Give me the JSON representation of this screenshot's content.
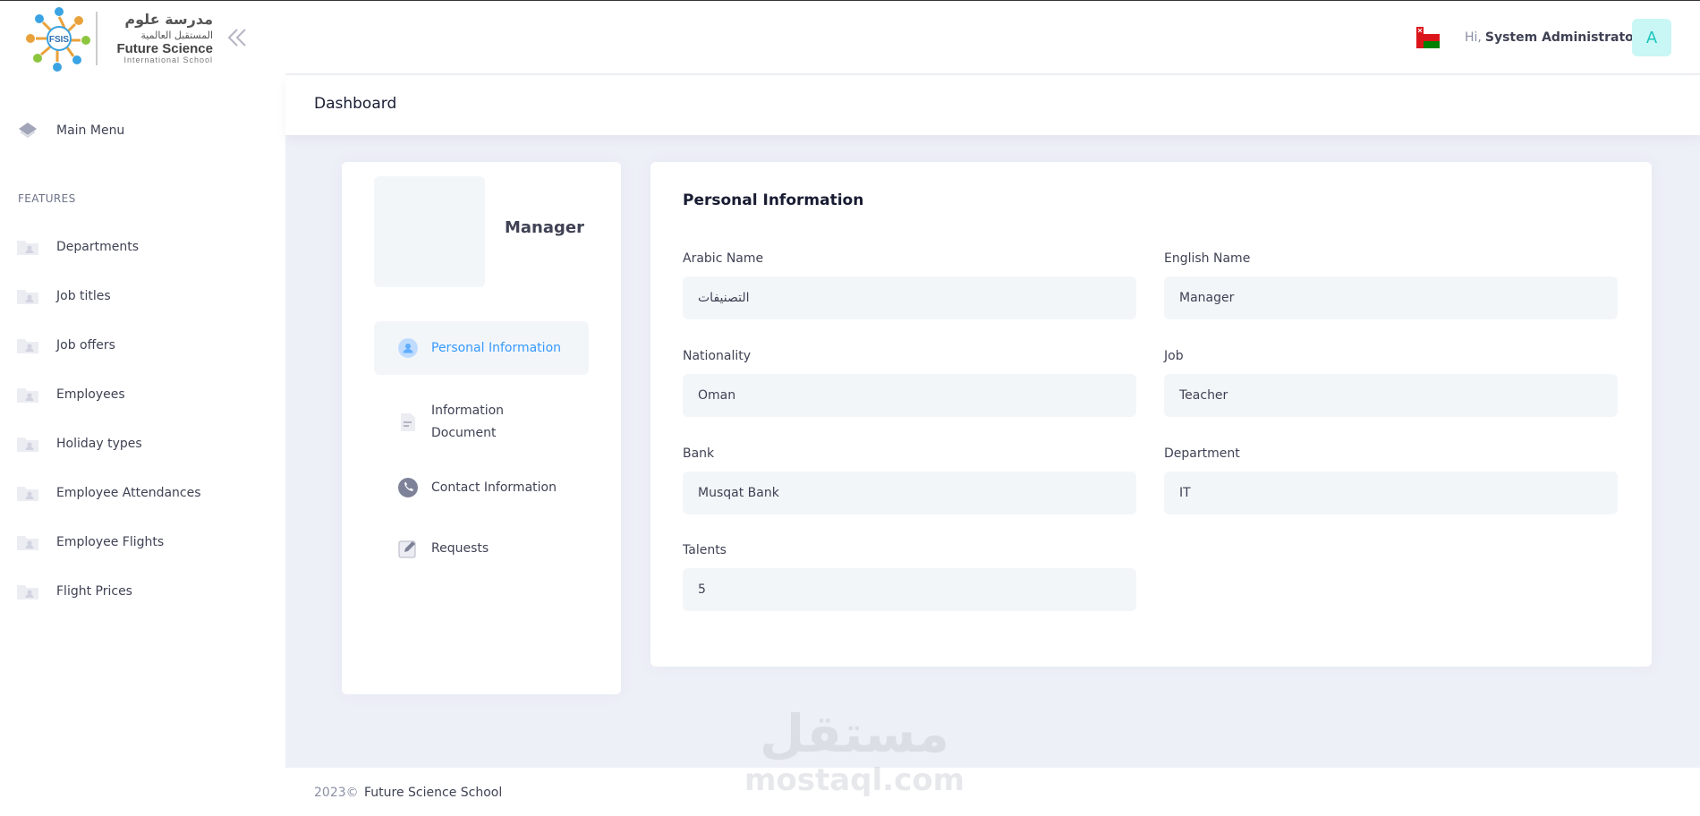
{
  "brand": {
    "logo_abbrev": "FSIS",
    "arabic_name_line1": "مدرسة علوم",
    "arabic_name_line2": "المستقبل العالمية",
    "english_name": "Future Science",
    "english_subtitle": "International School"
  },
  "sidebar": {
    "main_menu": "Main Menu",
    "section_title": "FEATURES",
    "items": [
      {
        "label": "Departments"
      },
      {
        "label": "Job titles"
      },
      {
        "label": "Job offers"
      },
      {
        "label": "Employees"
      },
      {
        "label": "Holiday types"
      },
      {
        "label": "Employee Attendances"
      },
      {
        "label": "Employee Flights"
      },
      {
        "label": "Flight Prices"
      }
    ]
  },
  "topbar": {
    "greeting_prefix": "Hi,",
    "user_name": "System Administrator",
    "avatar_initial": "A",
    "flag_icon": "oman-flag-icon"
  },
  "subheader": {
    "title": "Dashboard"
  },
  "profile": {
    "name": "Manager",
    "nav": [
      {
        "label": "Personal Information",
        "icon": "user-icon",
        "active": true
      },
      {
        "label": "Information Document",
        "icon": "document-icon",
        "active": false
      },
      {
        "label": "Contact Information",
        "icon": "phone-icon",
        "active": false
      },
      {
        "label": "Requests",
        "icon": "edit-icon",
        "active": false
      }
    ]
  },
  "personal_info": {
    "title": "Personal Information",
    "fields": {
      "arabic_name": {
        "label": "Arabic Name",
        "value": "التصنيفات"
      },
      "english_name": {
        "label": "English Name",
        "value": "Manager"
      },
      "nationality": {
        "label": "Nationality",
        "value": "Oman"
      },
      "job": {
        "label": "Job",
        "value": "Teacher"
      },
      "bank": {
        "label": "Bank",
        "value": "Musqat Bank"
      },
      "department": {
        "label": "Department",
        "value": "IT"
      },
      "talents": {
        "label": "Talents",
        "value": "5"
      }
    }
  },
  "footer": {
    "year": "2023©",
    "link": "Future Science School"
  },
  "watermark": {
    "arabic": "مستقل",
    "latin": "mostaql.com"
  },
  "colors": {
    "accent": "#3699ff",
    "avatar_bg": "#c9f7f5",
    "avatar_fg": "#1bc5bd",
    "page_bg": "#eef0f8",
    "input_bg": "#f3f6f9"
  }
}
